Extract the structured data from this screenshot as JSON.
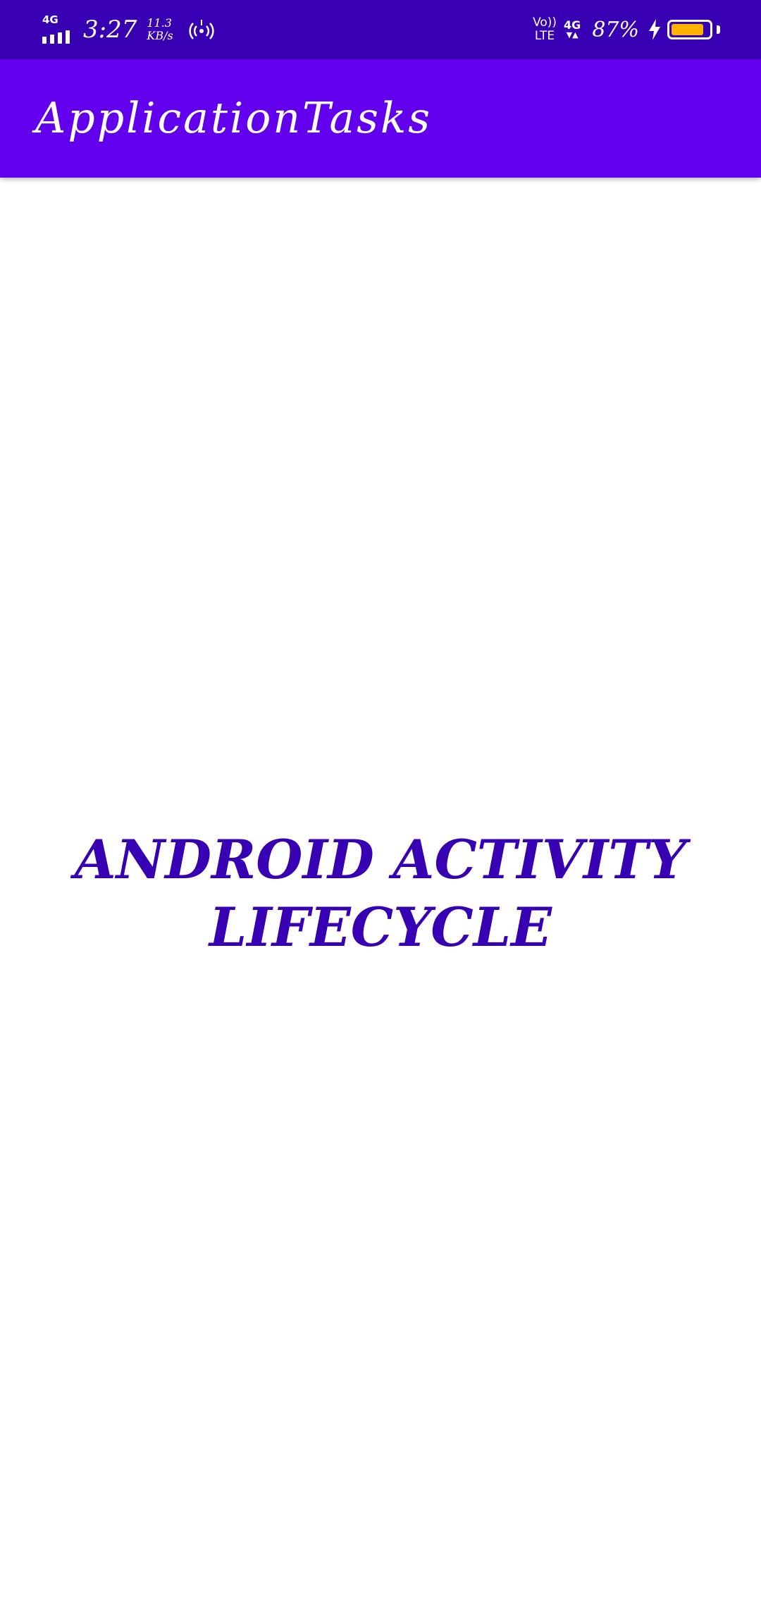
{
  "status_bar": {
    "network_type": "4G",
    "time": "3:27",
    "speed_value": "11.3",
    "speed_unit": "KB/s",
    "hotspot_icon": "hotspot-icon",
    "volte_top": "Vo))",
    "volte_bottom": "LTE",
    "data_network": "4G",
    "data_arrows": "▼▲",
    "battery_percent": "87%",
    "charging_icon": "bolt-icon",
    "battery_level": 0.87,
    "battery_color": "#ffb300",
    "background_color": "#3700b3"
  },
  "app_bar": {
    "title": "ApplicationTasks",
    "background_color": "#6200ee"
  },
  "main": {
    "heading_line1": "ANDROID ACTIVITY",
    "heading_line2": "LIFECYCLE",
    "heading_color": "#3700b3"
  }
}
